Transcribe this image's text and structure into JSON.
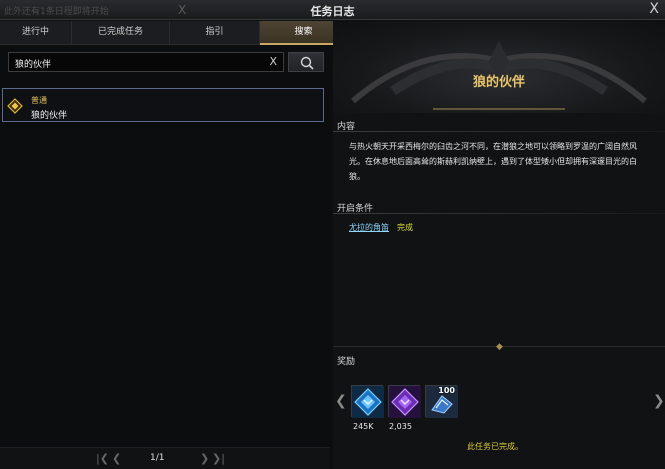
{
  "window": {
    "title": "任务日志",
    "ghost_notice": "此外还有1条日程即将开始",
    "close_glyph": "X"
  },
  "tabs": [
    {
      "label": "进行中",
      "active": false
    },
    {
      "label": "已完成任务",
      "active": false
    },
    {
      "label": "指引",
      "active": false
    },
    {
      "label": "搜索",
      "active": true
    }
  ],
  "search": {
    "value": "狼的伙伴",
    "clear_glyph": "X"
  },
  "results": [
    {
      "type": "普通",
      "name": "狼的伙伴",
      "icon": "quest-diamond-icon"
    }
  ],
  "pager": {
    "page": "1/1"
  },
  "detail": {
    "title": "狼的伙伴",
    "content_head": "内容",
    "description": "与热火朝天开采西梅尔的臼齿之河不同，在潜狼之地可以领略到罗温的广阔自然风光。在休息地后面高耸的斯赫利凯纳壁上，遇到了体型矮小但却拥有深邃目光的白狼。",
    "condition_head": "开启条件",
    "condition_link": "尤拉的角笛",
    "condition_status": "完成",
    "reward_head": "奖励",
    "rewards": [
      {
        "value": "245K",
        "icon": "blue-crystal-icon",
        "count": ""
      },
      {
        "value": "2,035",
        "icon": "purple-crystal-icon",
        "count": ""
      },
      {
        "value": "",
        "icon": "blue-item-icon",
        "count": "100"
      }
    ],
    "completed_text": "此任务已完成。"
  },
  "colors": {
    "accent_gold": "#e9c46d",
    "link_blue": "#8fd7ff",
    "status_yellow": "#d9dd3a"
  }
}
